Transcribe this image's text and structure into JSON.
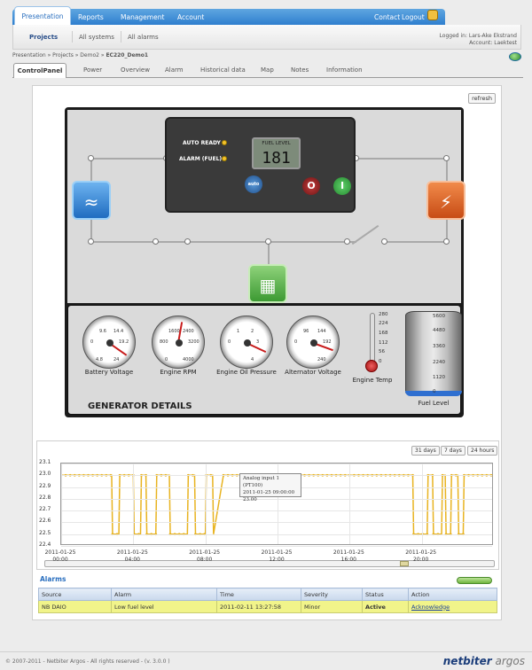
{
  "topnav": {
    "tabs": [
      "Presentation",
      "Reports",
      "Management",
      "Account"
    ],
    "contact": "Contact",
    "logout": "Logout"
  },
  "subnav": {
    "items": [
      "Projects",
      "All systems",
      "All alarms"
    ],
    "logged_in": "Logged in: Lars-Ake Ekstrand",
    "account": "Account: Laektest"
  },
  "breadcrumb": {
    "prefix": "Presentation » Projects » Demo2 » ",
    "current": "EC220_Demo1"
  },
  "device_tabs": [
    "ControlPanel",
    "Power",
    "Overview",
    "Alarm",
    "Historical data",
    "Map",
    "Notes",
    "Information"
  ],
  "refresh": "refresh",
  "control": {
    "auto_ready": "AUTO READY",
    "alarm_fuel": "ALARM (FUEL)",
    "fuel_label": "FUEL LEVEL",
    "fuel_value": "181",
    "auto_btn": "auto"
  },
  "gauges": [
    {
      "label": "Battery Voltage",
      "ticks": [
        "9.6",
        "14.4",
        "0",
        "19.2",
        "4.8",
        "24"
      ],
      "value_deg": 35
    },
    {
      "label": "Engine RPM",
      "ticks": [
        "1600",
        "2400",
        "800",
        "3200",
        "0",
        "4000"
      ],
      "value_deg": -80
    },
    {
      "label": "Engine Oil Pressure",
      "ticks": [
        "1",
        "2",
        "0",
        "3",
        "",
        "4"
      ],
      "value_deg": 25
    },
    {
      "label": "Alternator Voltage",
      "ticks": [
        "96",
        "144",
        "0",
        "192",
        "",
        "240"
      ],
      "value_deg": 20
    }
  ],
  "engine_temp": {
    "label": "Engine Temp",
    "ticks": [
      "280",
      "224",
      "168",
      "112",
      "56",
      "0"
    ]
  },
  "fuel_tank": {
    "label": "Fuel Level",
    "ticks": [
      "5600",
      "4480",
      "3360",
      "2240",
      "1120",
      "0"
    ],
    "level_fraction": 0.03
  },
  "generator_details": "GENERATOR DETAILS",
  "trend": {
    "ranges": [
      "31 days",
      "7 days",
      "24 hours"
    ],
    "tooltip": [
      "Analog input 1 (PT100)",
      "2011-01-25 09:00:00",
      "23.00"
    ]
  },
  "chart_data": {
    "type": "line",
    "title": "",
    "ylim": [
      22.4,
      23.1
    ],
    "yticks": [
      "23.1",
      "23.0",
      "22.9",
      "22.8",
      "22.7",
      "22.6",
      "22.5",
      "22.4"
    ],
    "xticks": [
      [
        "2011-01-25",
        "00:00"
      ],
      [
        "2011-01-25",
        "04:00"
      ],
      [
        "2011-01-25",
        "08:00"
      ],
      [
        "2011-01-25",
        "12:00"
      ],
      [
        "2011-01-25",
        "16:00"
      ],
      [
        "2011-01-25",
        "20:00"
      ]
    ],
    "series": [
      {
        "name": "Analog input 1 (PT100)",
        "color": "#e8b320",
        "x": [
          0,
          2.8,
          2.85,
          3.2,
          3.25,
          4.0,
          4.05,
          4.4,
          4.45,
          4.7,
          4.75,
          5.25,
          5.3,
          6.0,
          6.05,
          7.0,
          7.05,
          7.4,
          7.45,
          8.0,
          8.05,
          8.4,
          8.45,
          9.0,
          19.5,
          19.55,
          20.3,
          20.35,
          20.6,
          20.65,
          21.1,
          21.15,
          21.3,
          21.35,
          21.6,
          21.65,
          22.0,
          22.05,
          22.3,
          22.35,
          23.9
        ],
        "values": [
          23.0,
          23.0,
          22.5,
          22.5,
          23.0,
          23.0,
          22.5,
          22.5,
          23.0,
          23.0,
          22.5,
          22.5,
          23.0,
          23.0,
          22.5,
          22.5,
          23.0,
          23.0,
          22.5,
          22.5,
          23.0,
          23.0,
          22.5,
          23.0,
          23.0,
          22.5,
          22.5,
          23.0,
          23.0,
          22.5,
          22.5,
          23.0,
          23.0,
          22.5,
          22.5,
          23.0,
          23.0,
          22.5,
          22.5,
          23.0,
          23.0
        ]
      }
    ]
  },
  "alarms": {
    "title": "Alarms",
    "headers": [
      "Source",
      "Alarm",
      "Time",
      "Severity",
      "Status",
      "Action"
    ],
    "rows": [
      [
        "NB DAIO",
        "Low fuel level",
        "2011-02-11 13:27:58",
        "Minor",
        "Active",
        "Acknowledge"
      ]
    ]
  },
  "footer": {
    "text": "© 2007-2011 - Netbiter Argos - All rights reserved - (v. 3.0.0 )",
    "brand": "netbiter",
    "brand2": " argos"
  }
}
